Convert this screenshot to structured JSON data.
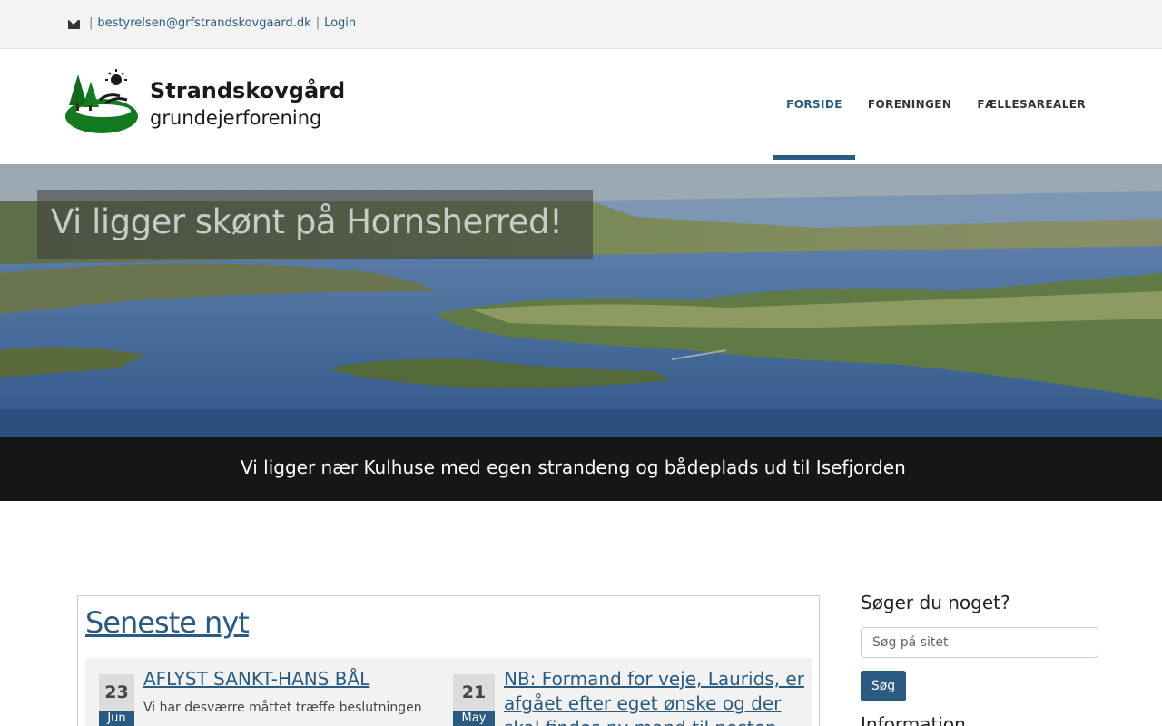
{
  "topbar": {
    "email": "bestyrelsen@grfstrandskovgaard.dk",
    "separator1": "|",
    "separator2": "|",
    "login_label": "Login"
  },
  "logo": {
    "line1": "Strandskovgård",
    "line2": "grundejerforening"
  },
  "nav": {
    "items": [
      {
        "label": "FORSIDE",
        "active": true
      },
      {
        "label": "FORENINGEN",
        "active": false
      },
      {
        "label": "FÆLLESAREALER",
        "active": false
      }
    ]
  },
  "hero": {
    "title": "Vi ligger skønt på Hornsherred!",
    "caption": "Vi ligger nær Kulhuse med egen strandeng og bådeplads ud til Isefjorden"
  },
  "news": {
    "title": "Seneste nyt",
    "items": [
      {
        "day": "23",
        "month": "Jun",
        "title": "AFLYST SANKT-HANS BÅL",
        "excerpt": "Vi har desværre måttet træffe beslutningen"
      },
      {
        "day": "21",
        "month": "May",
        "title_lines": [
          "NB: Formand for veje, Laurids, er",
          "afgået efter eget ønske og der",
          "skal findes ny mand til posten"
        ]
      }
    ]
  },
  "sidebar": {
    "search_heading": "Søger du noget?",
    "search_placeholder": "Søg på sitet",
    "search_button": "Søg",
    "info_heading": "Information"
  },
  "colors": {
    "accent": "#2a5a80",
    "topbar_bg": "#f3f3f3",
    "caption_bg": "#161616"
  }
}
